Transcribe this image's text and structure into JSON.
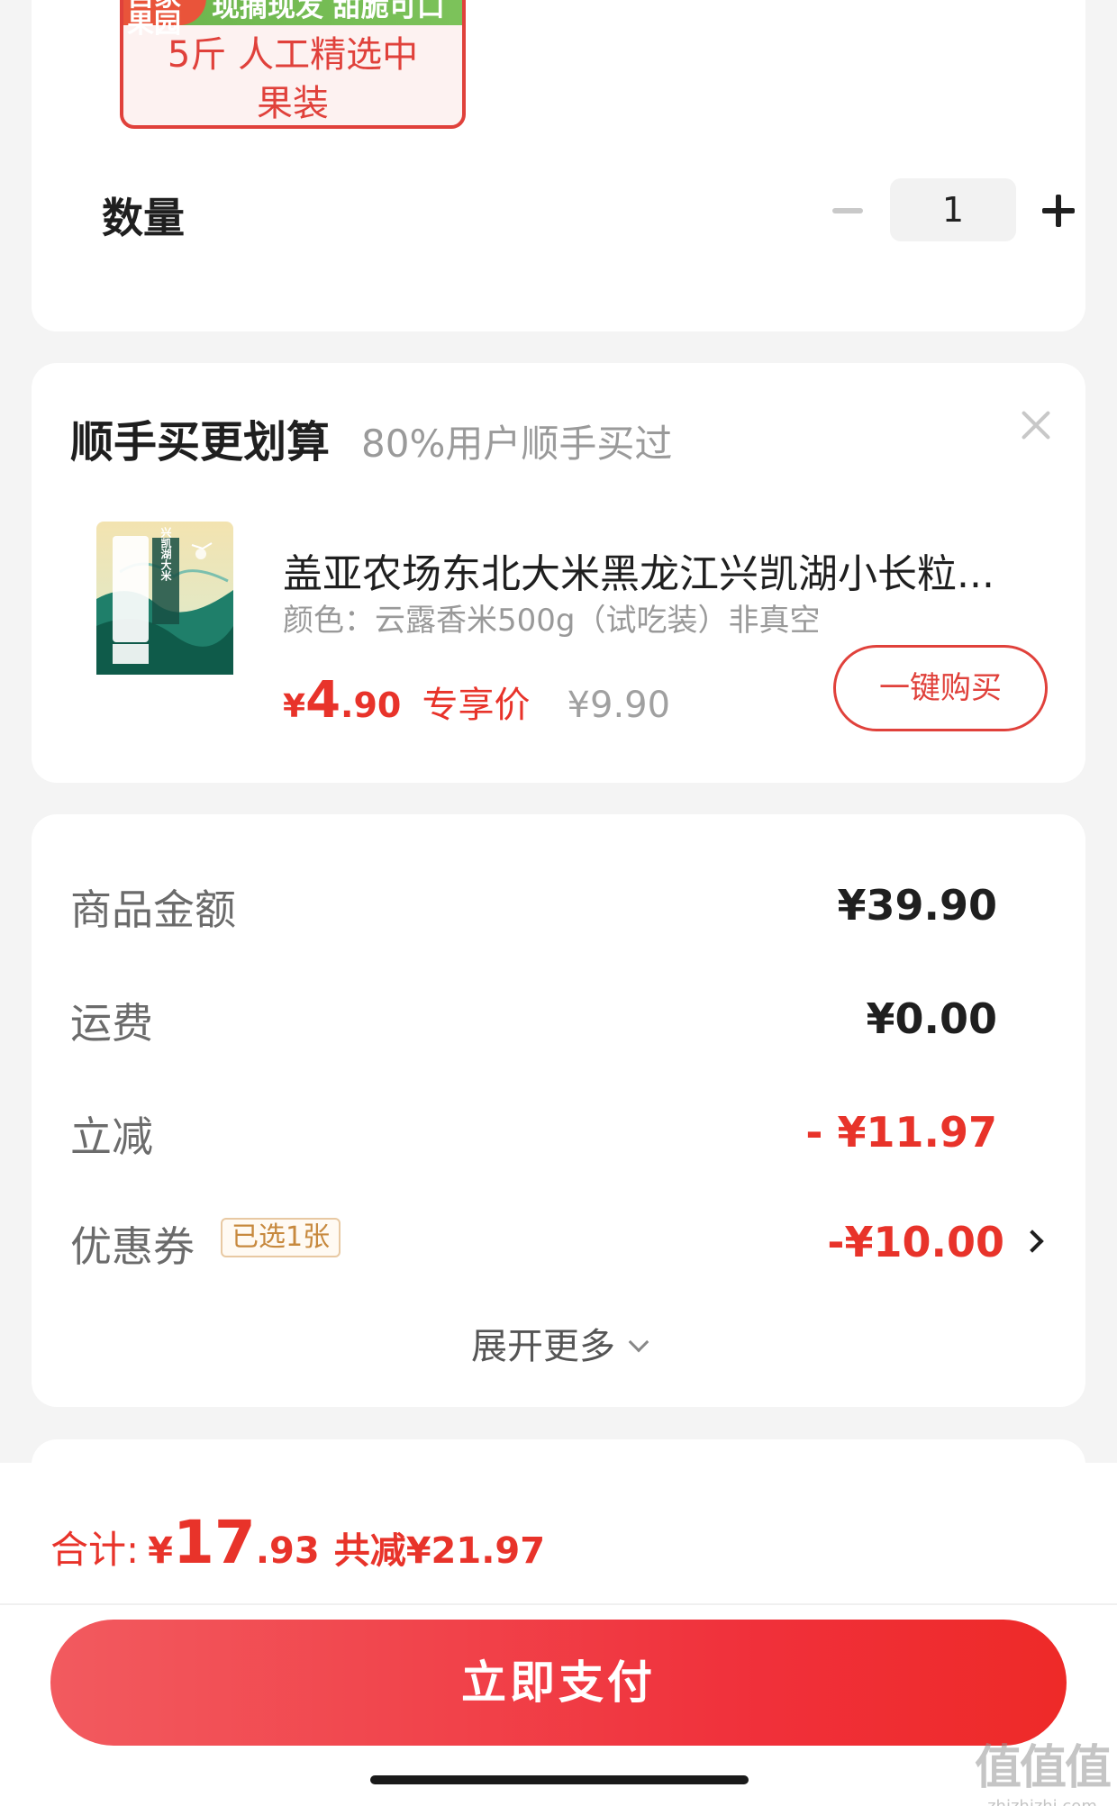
{
  "sku": {
    "badge": "自家果园",
    "banner": "现摘现发 甜脆可口",
    "name_line1": "5斤 人工精选中",
    "name_line2": "果装"
  },
  "quantity": {
    "label": "数量",
    "value": "1"
  },
  "upsell": {
    "title": "顺手买更划算",
    "subtitle": "80%用户顺手买过",
    "product": {
      "title": "盖亚农场东北大米黑龙江兴凯湖小长粒...",
      "spec": "颜色：云露香米500g（试吃装）非真空",
      "price_currency": "¥",
      "price_int": "4",
      "price_dec": ".90",
      "price_tag": "专享价",
      "original_price": "¥9.90",
      "package_text": "兴凯湖大米"
    },
    "buy_button": "一键购买"
  },
  "summary": {
    "rows": [
      {
        "label": "商品金额",
        "value": "¥39.90"
      },
      {
        "label": "运费",
        "value": "¥0.00"
      },
      {
        "label": "立减",
        "value": "- ¥11.97"
      },
      {
        "label": "优惠券",
        "value": "-¥10.00",
        "tag": "已选1张"
      }
    ],
    "expand": "展开更多"
  },
  "bottom": {
    "total_label": "合计:",
    "total_currency": "¥",
    "total_int": "17",
    "total_dec": ".93",
    "total_saved": "共减¥21.97",
    "pay_button": "立即支付"
  },
  "watermark": {
    "main": "值值值",
    "sub": "zhizhizhi.com"
  },
  "colors": {
    "accent_red": "#e8332a",
    "sku_green": "#6bb44c",
    "coupon_gold": "#c7893e"
  }
}
